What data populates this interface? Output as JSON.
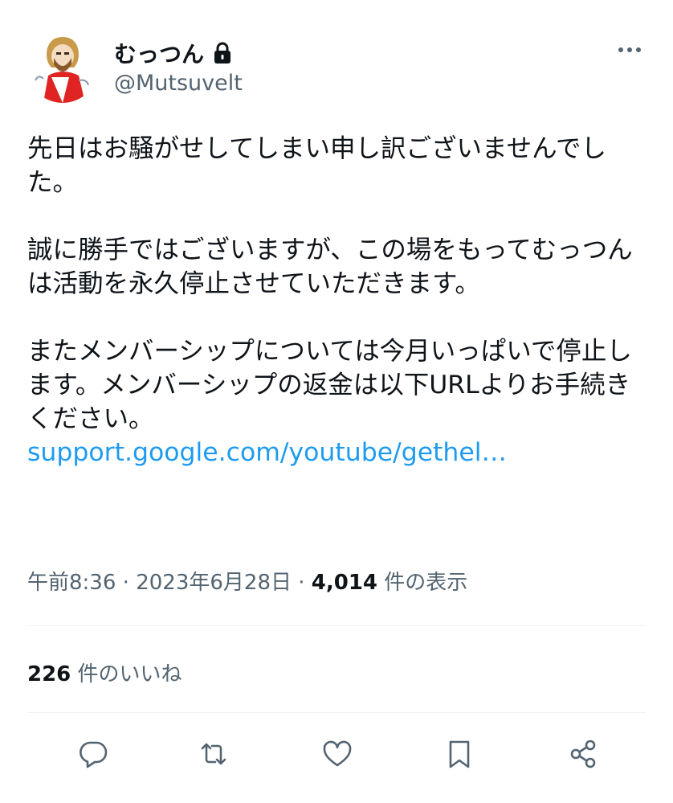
{
  "user": {
    "display_name": "むっつん",
    "handle": "@Mutsuvelt",
    "protected_icon": "lock-icon",
    "avatar": "illustrated-avatar"
  },
  "tweet": {
    "paragraphs": [
      "先日はお騒がせしてしまい申し訳ございませんでした。",
      "誠に勝手ではございますが、この場をもってむっつんは活動を永久停止させていただきます。",
      "またメンバーシップについては今月いっぱいで停止します。メンバーシップの返金は以下URLよりお手続きください。"
    ],
    "link": "support.google.com/youtube/gethel…",
    "link_color": "#1d9bf0"
  },
  "meta": {
    "time": "午前8:36",
    "date": "2023年6月28日",
    "views_count": "4,014",
    "views_label": "件の表示",
    "separator": "·"
  },
  "likes": {
    "count": "226",
    "label": "件のいいね"
  },
  "actions": [
    "reply-icon",
    "retweet-icon",
    "like-icon",
    "bookmark-icon",
    "share-icon"
  ],
  "colors": {
    "text": "#0f1419",
    "secondary": "#536471",
    "divider": "#eff3f4"
  }
}
